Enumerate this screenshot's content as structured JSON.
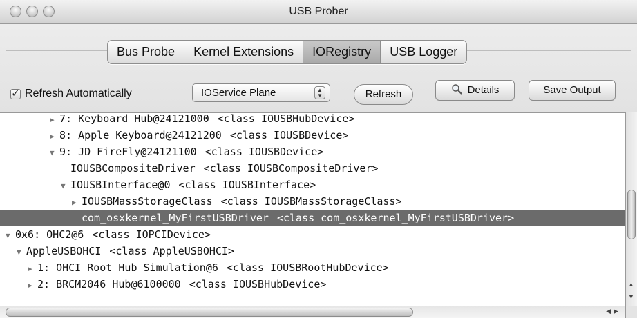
{
  "window": {
    "title": "USB Prober"
  },
  "tabs": [
    {
      "label": "Bus Probe",
      "selected": false
    },
    {
      "label": "Kernel Extensions",
      "selected": false
    },
    {
      "label": "IORegistry",
      "selected": true
    },
    {
      "label": "USB Logger",
      "selected": false
    }
  ],
  "controls": {
    "refresh_auto_label": "Refresh Automatically",
    "refresh_auto_checked": true,
    "plane_select_value": "IOService Plane",
    "refresh_button": "Refresh",
    "details_button": "Details",
    "save_button": "Save Output"
  },
  "tree": [
    {
      "indent": 0,
      "tri": "closed",
      "name": "7: Keyboard Hub@24121000",
      "cls": "<class IOUSBHubDevice>"
    },
    {
      "indent": 0,
      "tri": "closed",
      "name": "8: Apple Keyboard@24121200",
      "cls": "<class IOUSBDevice>"
    },
    {
      "indent": 0,
      "tri": "open",
      "name": "9: JD FireFly@24121100",
      "cls": "<class IOUSBDevice>"
    },
    {
      "indent": 1,
      "tri": "none",
      "name": "IOUSBCompositeDriver",
      "cls": "<class IOUSBCompositeDriver>"
    },
    {
      "indent": 1,
      "tri": "open",
      "name": "IOUSBInterface@0",
      "cls": "<class IOUSBInterface>"
    },
    {
      "indent": 2,
      "tri": "closed",
      "name": "IOUSBMassStorageClass",
      "cls": "<class IOUSBMassStorageClass>"
    },
    {
      "indent": 2,
      "tri": "none",
      "name": "com_osxkernel_MyFirstUSBDriver",
      "cls": "<class com_osxkernel_MyFirstUSBDriver>",
      "selected": true
    },
    {
      "indent": -4,
      "tri": "open",
      "name": "0x6: OHC2@6",
      "cls": "<class IOPCIDevice>"
    },
    {
      "indent": -3,
      "tri": "open",
      "name": "AppleUSBOHCI",
      "cls": "<class AppleUSBOHCI>"
    },
    {
      "indent": -2,
      "tri": "closed",
      "name": "1: OHCI Root Hub Simulation@6",
      "cls": "<class IOUSBRootHubDevice>"
    },
    {
      "indent": -2,
      "tri": "closed",
      "name": "2: BRCM2046 Hub@6100000",
      "cls": "<class IOUSBHubDevice>"
    }
  ],
  "icons": {
    "details": "magnifier-icon",
    "expanded": "disclosure-triangle-down-icon",
    "collapsed": "disclosure-triangle-right-icon"
  }
}
